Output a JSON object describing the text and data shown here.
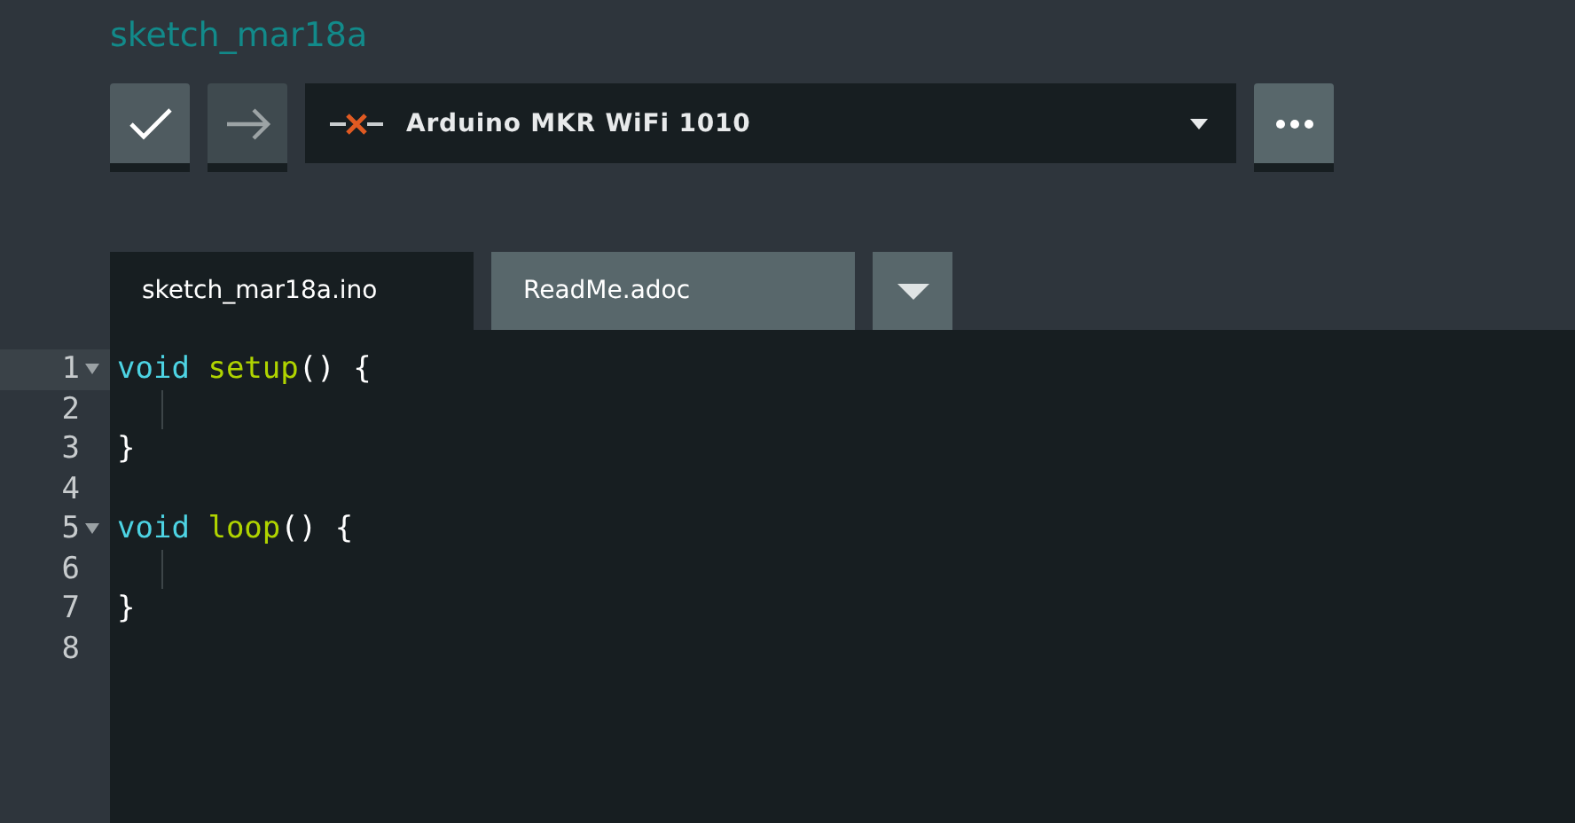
{
  "sketch": {
    "title": "sketch_mar18a"
  },
  "toolbar": {
    "buttons": [
      {
        "kind": "verify",
        "disabled": false
      },
      {
        "kind": "upload",
        "disabled": true
      }
    ],
    "board": {
      "label": "Arduino MKR WiFi 1010",
      "connected": false
    }
  },
  "tabs": [
    {
      "label": "sketch_mar18a.ino",
      "selected": true
    },
    {
      "label": "ReadMe.adoc",
      "selected": false
    }
  ],
  "editor": {
    "lines": [
      {
        "number": "1",
        "foldable": true,
        "selected": true,
        "guide": false,
        "tokens": [
          {
            "kind": "keyword",
            "text": "void"
          },
          {
            "kind": "function",
            "text": "setup"
          },
          {
            "kind": "plain",
            "text": "() {"
          }
        ]
      },
      {
        "number": "2",
        "foldable": false,
        "selected": false,
        "guide": true
      },
      {
        "number": "3",
        "foldable": false,
        "selected": false,
        "guide": false,
        "tokens": [
          {
            "kind": "plain",
            "text": "}"
          }
        ]
      },
      {
        "number": "4",
        "foldable": false,
        "selected": false,
        "guide": false
      },
      {
        "number": "5",
        "foldable": true,
        "selected": false,
        "guide": false,
        "tokens": [
          {
            "kind": "keyword",
            "text": "void"
          },
          {
            "kind": "function",
            "text": "loop"
          },
          {
            "kind": "plain",
            "text": "() {"
          }
        ]
      },
      {
        "number": "6",
        "foldable": false,
        "selected": false,
        "guide": true
      },
      {
        "number": "7",
        "foldable": false,
        "selected": false,
        "guide": false,
        "tokens": [
          {
            "kind": "plain",
            "text": "}"
          }
        ]
      },
      {
        "number": "8",
        "foldable": false,
        "selected": false,
        "guide": false
      }
    ]
  }
}
